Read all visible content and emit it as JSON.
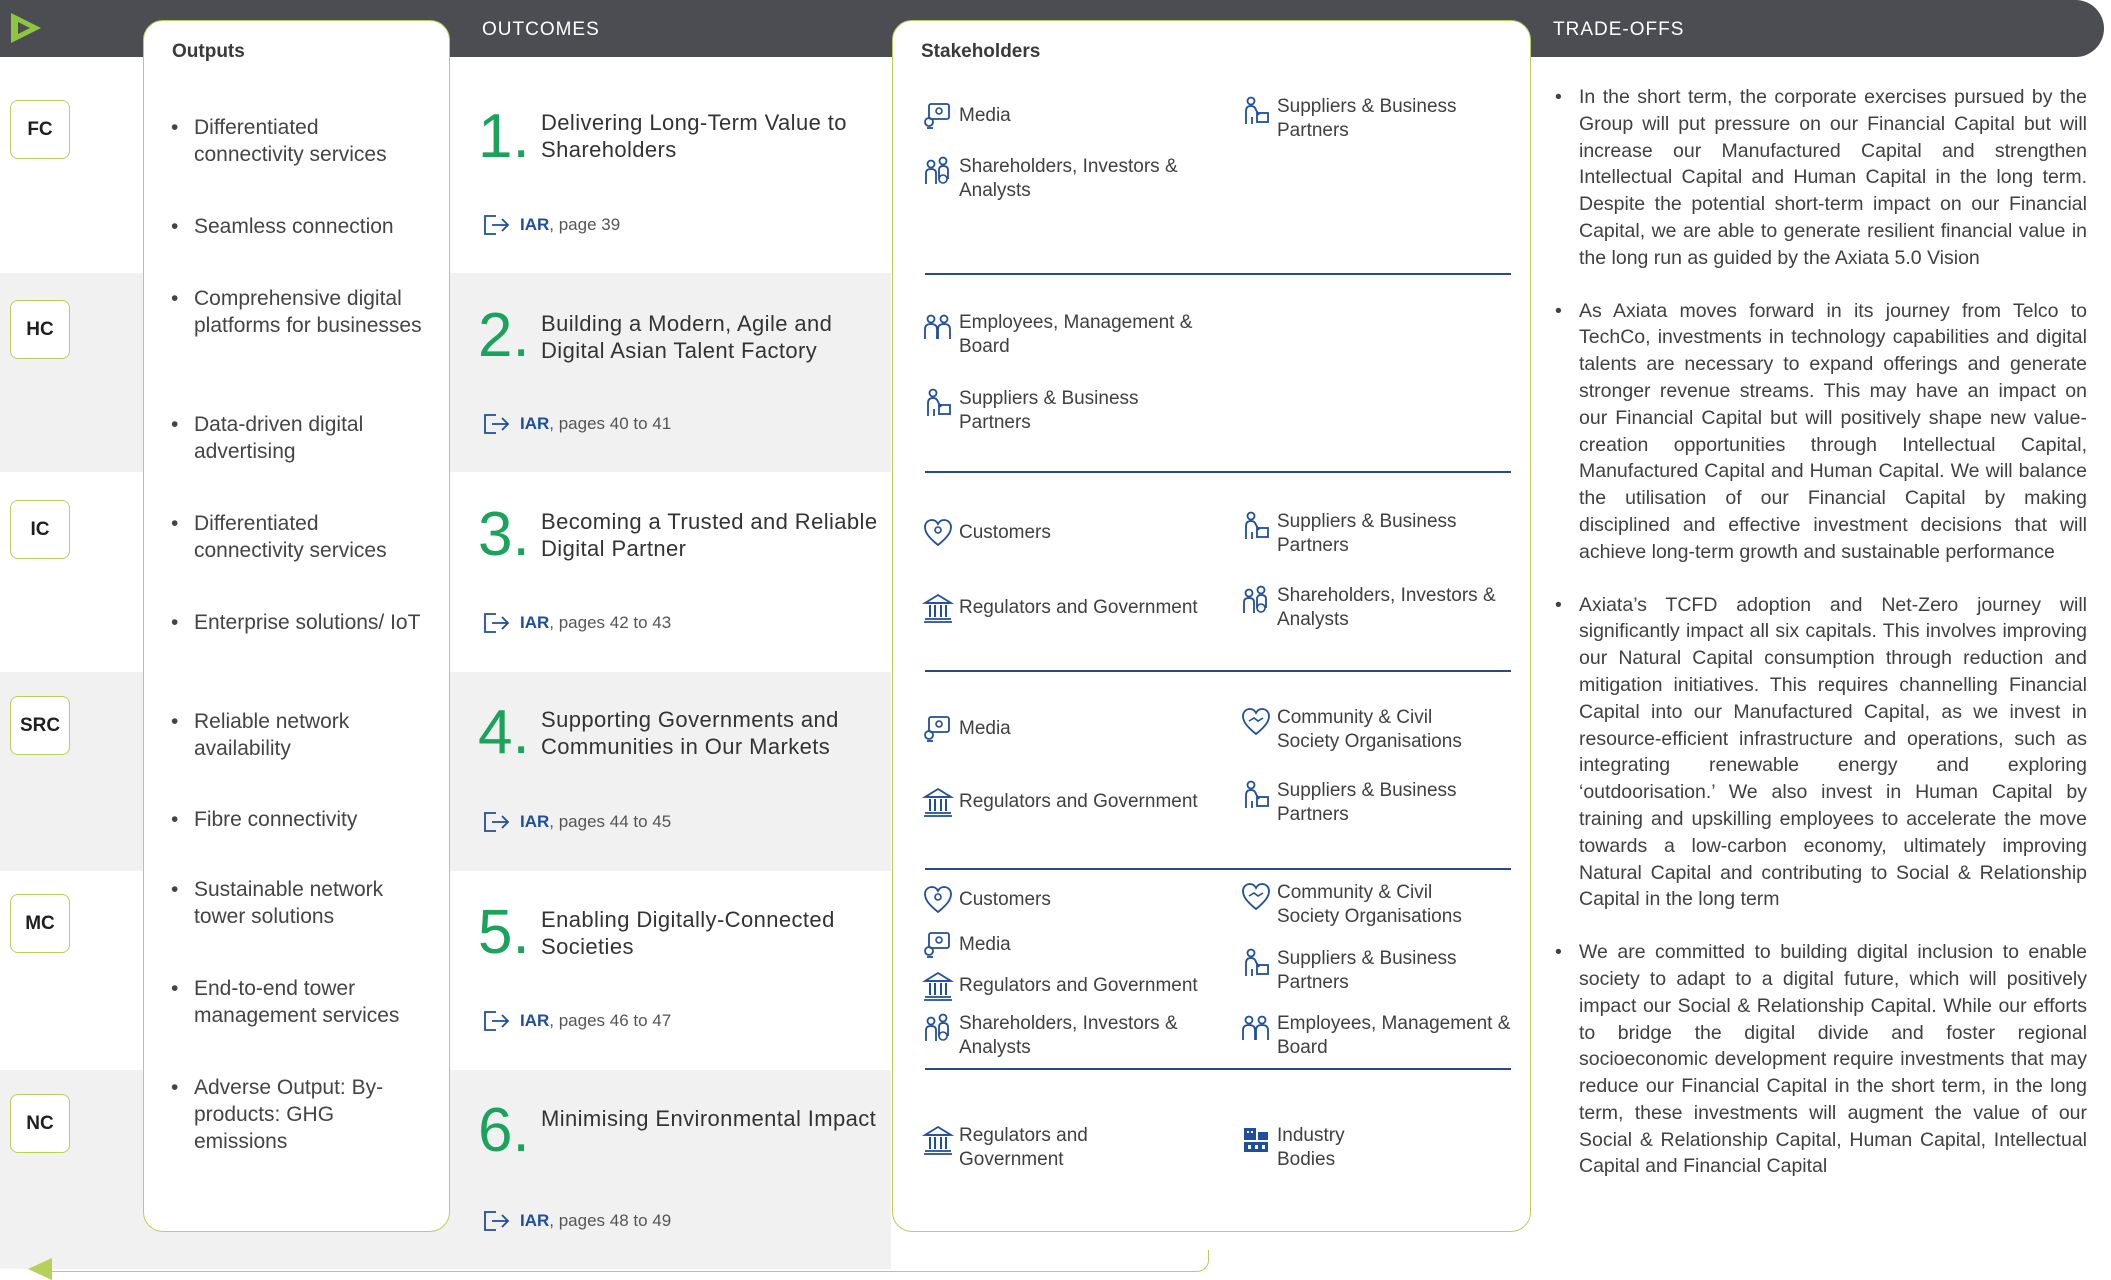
{
  "header": {
    "outcomes_label": "OUTCOMES",
    "tradeoffs_label": "TRADE-OFFS"
  },
  "capitals": [
    "FC",
    "HC",
    "IC",
    "SRC",
    "MC",
    "NC"
  ],
  "outputs": {
    "title": "Outputs",
    "items": [
      "Differentiated connectivity services",
      "Seamless connection",
      "Comprehensive digital platforms for businesses",
      "Data-driven digital advertising",
      "Differentiated connectivity services",
      "Enterprise solutions/ IoT",
      "Reliable network availability",
      "Fibre connectivity",
      "Sustainable network tower solutions",
      "End-to-end tower management services",
      "Adverse Output: By-products: GHG emissions"
    ]
  },
  "outcomes": [
    {
      "number": "1.",
      "title": "Delivering Long-Term Value to Shareholders",
      "iar_label": "IAR",
      "iar_pages": ", page 39"
    },
    {
      "number": "2.",
      "title": "Building a Modern, Agile and Digital Asian Talent Factory",
      "iar_label": "IAR",
      "iar_pages": ", pages 40 to 41"
    },
    {
      "number": "3.",
      "title": "Becoming a Trusted and Reliable Digital Partner",
      "iar_label": "IAR",
      "iar_pages": ", pages 42 to 43"
    },
    {
      "number": "4.",
      "title": "Supporting Governments and Communities in Our Markets",
      "iar_label": "IAR",
      "iar_pages": ", pages 44 to 45"
    },
    {
      "number": "5.",
      "title": "Enabling Digitally-Connected Societies",
      "iar_label": "IAR",
      "iar_pages": ", pages 46 to 47"
    },
    {
      "number": "6.",
      "title": "Minimising Environmental Impact",
      "iar_label": "IAR",
      "iar_pages": ", pages 48 to 49"
    }
  ],
  "stakeholders": {
    "title": "Stakeholders",
    "groups": [
      [
        {
          "icon": "media-icon",
          "label": "Media"
        },
        {
          "icon": "suppliers-icon",
          "label": "Suppliers & Business Partners"
        },
        {
          "icon": "shareholders-icon",
          "label": "Shareholders, Investors & Analysts"
        }
      ],
      [
        {
          "icon": "employees-icon",
          "label": "Employees, Management & Board"
        },
        {
          "icon": "suppliers-icon",
          "label": "Suppliers & Business Partners"
        }
      ],
      [
        {
          "icon": "customers-icon",
          "label": "Customers"
        },
        {
          "icon": "suppliers-icon",
          "label": "Suppliers & Business Partners"
        },
        {
          "icon": "regulators-icon",
          "label": "Regulators and Government"
        },
        {
          "icon": "shareholders-icon",
          "label": "Shareholders, Investors & Analysts"
        }
      ],
      [
        {
          "icon": "media-icon",
          "label": "Media"
        },
        {
          "icon": "community-icon",
          "label": "Community & Civil Society Organisations"
        },
        {
          "icon": "regulators-icon",
          "label": "Regulators and Government"
        },
        {
          "icon": "suppliers-icon",
          "label": "Suppliers & Business Partners"
        }
      ],
      [
        {
          "icon": "customers-icon",
          "label": "Customers"
        },
        {
          "icon": "community-icon",
          "label": "Community & Civil Society Organisations"
        },
        {
          "icon": "media-icon",
          "label": "Media"
        },
        {
          "icon": "regulators-icon",
          "label": "Regulators and Government"
        },
        {
          "icon": "suppliers-icon",
          "label": "Suppliers & Business Partners"
        },
        {
          "icon": "shareholders-icon",
          "label": "Shareholders, Investors & Analysts"
        },
        {
          "icon": "employees-icon",
          "label": "Employees, Management & Board"
        }
      ],
      [
        {
          "icon": "regulators-icon",
          "label": "Regulators and Government"
        },
        {
          "icon": "industry-icon",
          "label": "Industry Bodies"
        }
      ]
    ]
  },
  "tradeoffs": [
    "In the short term, the corporate exercises pursued by the Group will put pressure on our Financial Capital but will increase our Manufactured Capital and strengthen Intellectual Capital and Human Capital in the long term. Despite the potential short-term impact on our Financial Capital, we are able to generate resilient financial value in the long run as guided by the Axiata 5.0 Vision",
    "As Axiata moves forward in its journey from Telco to TechCo, investments in technology capabilities and digital talents are necessary to expand offerings and generate stronger revenue streams. This may have an impact on our Financial Capital but will positively shape new value-creation opportunities through Intellectual Capital, Manufactured Capital and Human Capital. We will balance the utilisation of our Financial Capital by making disciplined and effective investment decisions that will achieve long-term growth and sustainable performance",
    "Axiata’s TCFD adoption and Net-Zero journey will significantly impact all six capitals. This involves improving our Natural Capital consumption through reduction and mitigation initiatives. This requires channelling Financial Capital into our Manufactured Capital, as we invest in resource-efficient infrastructure and operations, such as integrating renewable energy and exploring ‘outdoorisation.’ We also invest in Human Capital by training and upskilling employees to accelerate the move towards a low-carbon economy, ultimately improving Natural Capital and contributing to Social & Relationship Capital in the long term",
    "We are committed to building digital inclusion to enable society to adapt to a digital future, which will positively impact our Social & Relationship Capital. While our efforts to bridge the digital divide and foster regional socioeconomic development require investments that may reduce our Financial Capital in the short term, in the long term, these investments will augment the value of our Social & Relationship Capital, Human Capital, Intellectual Capital and Financial Capital"
  ]
}
